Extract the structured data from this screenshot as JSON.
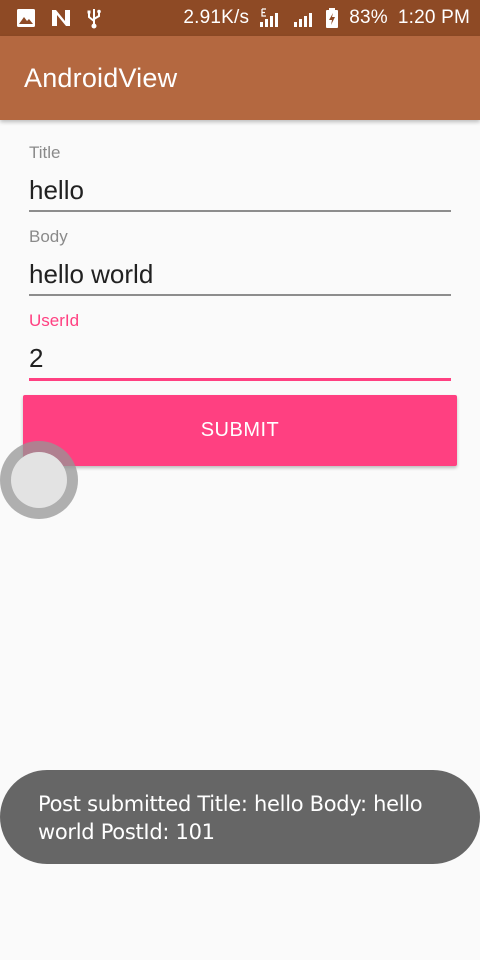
{
  "status_bar": {
    "network_speed": "2.91K/s",
    "battery_percent": "83%",
    "time": "1:20 PM",
    "icons": [
      "image-icon",
      "n-icon",
      "usb-icon",
      "signal-icon",
      "signal-icon",
      "battery-icon"
    ],
    "background_color": "#8e4a25"
  },
  "app_bar": {
    "title": "AndroidView",
    "background_color": "#b46840"
  },
  "form": {
    "fields": [
      {
        "label": "Title",
        "value": "hello",
        "focused": false
      },
      {
        "label": "Body",
        "value": "hello world",
        "focused": false
      },
      {
        "label": "UserId",
        "value": "2",
        "focused": true
      }
    ],
    "submit_label": "SUBMIT",
    "accent_color": "#ff4081"
  },
  "toast": {
    "message": "Post submitted Title: hello Body: hello world PostId: 101"
  }
}
